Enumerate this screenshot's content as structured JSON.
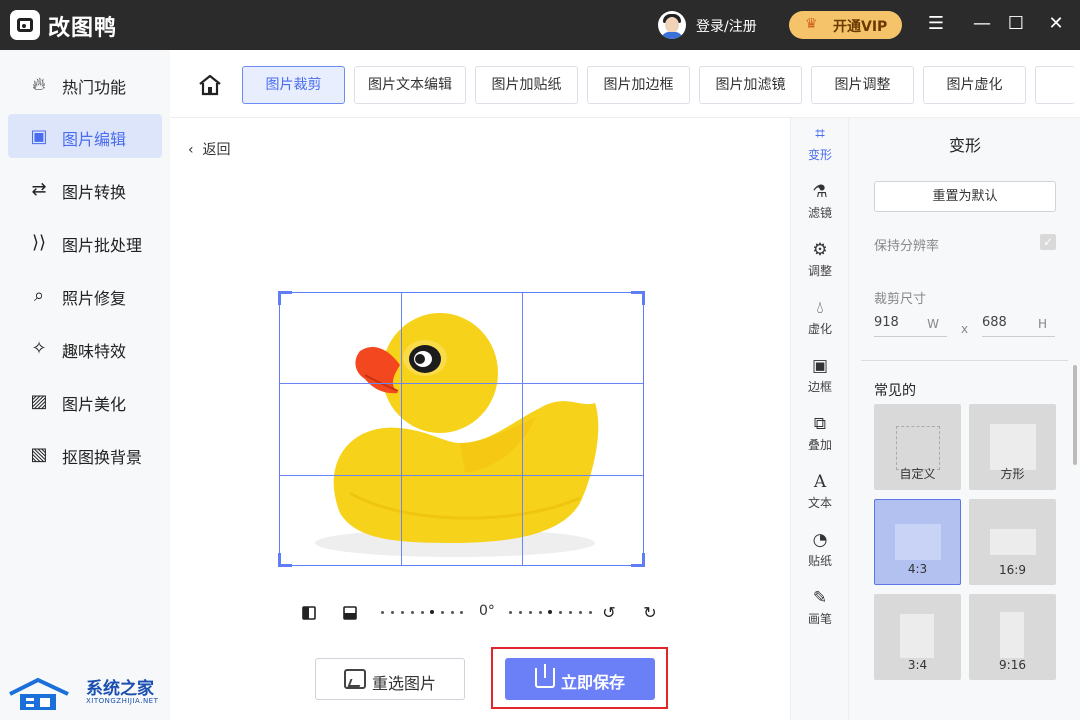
{
  "titlebar": {
    "app_title": "改图鸭",
    "login": "登录/注册",
    "vip": "开通VIP",
    "menu_glyph": "☰",
    "minimize_glyph": "—",
    "maximize_glyph": "☐",
    "close_glyph": "✕"
  },
  "sidebar": {
    "items": [
      {
        "label": "热门功能",
        "icon": "flame-icon",
        "glyph": "🔥︎"
      },
      {
        "label": "图片编辑",
        "icon": "image-edit-icon",
        "glyph": "▣"
      },
      {
        "label": "图片转换",
        "icon": "convert-icon",
        "glyph": "⇄"
      },
      {
        "label": "图片批处理",
        "icon": "batch-icon",
        "glyph": "⟩⟩"
      },
      {
        "label": "照片修复",
        "icon": "repair-icon",
        "glyph": "⌕"
      },
      {
        "label": "趣味特效",
        "icon": "magic-wand-icon",
        "glyph": "✧"
      },
      {
        "label": "图片美化",
        "icon": "beautify-icon",
        "glyph": "▨"
      },
      {
        "label": "抠图换背景",
        "icon": "cutout-icon",
        "glyph": "▧"
      }
    ]
  },
  "tabs": [
    {
      "label": "图片裁剪"
    },
    {
      "label": "图片文本编辑"
    },
    {
      "label": "图片加贴纸"
    },
    {
      "label": "图片加边框"
    },
    {
      "label": "图片加滤镜"
    },
    {
      "label": "图片调整"
    },
    {
      "label": "图片虚化"
    }
  ],
  "editor": {
    "back": "返回",
    "rotation": "0°",
    "reselect": "重选图片",
    "save": "立即保存"
  },
  "tools": [
    {
      "label": "变形",
      "icon": "crop-icon",
      "glyph": "⌗"
    },
    {
      "label": "滤镜",
      "icon": "flask-icon",
      "glyph": "⚗"
    },
    {
      "label": "调整",
      "icon": "sliders-icon",
      "glyph": "⚙"
    },
    {
      "label": "虚化",
      "icon": "droplet-icon",
      "glyph": "💧︎"
    },
    {
      "label": "边框",
      "icon": "frame-icon",
      "glyph": "▣"
    },
    {
      "label": "叠加",
      "icon": "overlay-icon",
      "glyph": "⧉"
    },
    {
      "label": "文本",
      "icon": "text-icon",
      "glyph": "A"
    },
    {
      "label": "贴纸",
      "icon": "sticker-icon",
      "glyph": "◔"
    },
    {
      "label": "画笔",
      "icon": "brush-icon",
      "glyph": "✎"
    }
  ],
  "panel": {
    "title": "变形",
    "reset": "重置为默认",
    "keep_resolution": "保持分辨率",
    "check_glyph": "✓",
    "crop_size_label": "裁剪尺寸",
    "width": "918",
    "width_unit": "W",
    "height": "688",
    "height_unit": "H",
    "x_sep": "x",
    "common_label": "常见的",
    "presets": [
      {
        "label": "自定义"
      },
      {
        "label": "方形"
      },
      {
        "label": "4:3"
      },
      {
        "label": "16:9"
      },
      {
        "label": "3:4"
      },
      {
        "label": "9:16"
      }
    ]
  },
  "watermark": {
    "cn": "系统之家",
    "en": "XITONGZHIJIA.NET"
  },
  "colors": {
    "accent": "#6b7ff7",
    "active_text": "#4a6cf0",
    "highlight_border": "#e0262a",
    "duck_yellow": "#f7d21b",
    "duck_beak": "#f2471f"
  }
}
